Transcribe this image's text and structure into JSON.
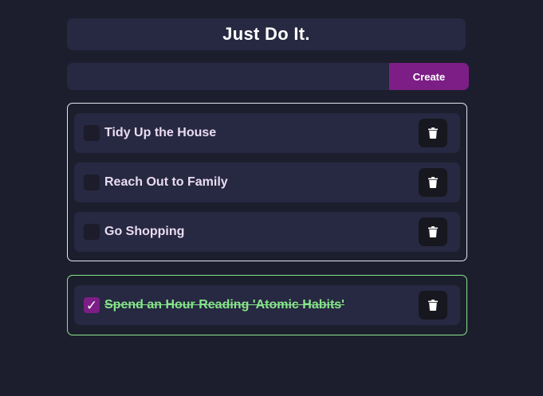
{
  "header": {
    "title": "Just Do It."
  },
  "create": {
    "placeholder": "",
    "value": "",
    "button_label": "Create"
  },
  "pending_tasks": [
    {
      "label": "Tidy Up the House",
      "checked": false
    },
    {
      "label": "Reach Out to Family",
      "checked": false
    },
    {
      "label": "Go Shopping",
      "checked": false
    }
  ],
  "completed_tasks": [
    {
      "label": "Spend an Hour Reading 'Atomic Habits'",
      "checked": true,
      "check_glyph": "✓"
    }
  ],
  "colors": {
    "background": "#1d1e2d",
    "panel": "#272841",
    "accent": "#7c1e86",
    "completed": "#86e58a",
    "pending_border": "#e6e6f0"
  },
  "icons": {
    "delete": "trash-icon"
  }
}
